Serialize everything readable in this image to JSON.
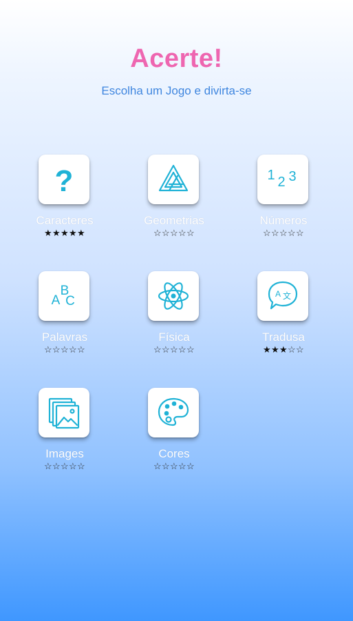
{
  "header": {
    "title": "Acerte!",
    "subtitle": "Escolha um Jogo e divirta-se"
  },
  "games": [
    {
      "label": "Caracteres",
      "icon": "question-mark-icon",
      "rating": 5,
      "max_rating": 5
    },
    {
      "label": "Geometrias",
      "icon": "impossible-triangle-icon",
      "rating": 0,
      "max_rating": 5
    },
    {
      "label": "Números",
      "icon": "numbers-123-icon",
      "rating": 0,
      "max_rating": 5
    },
    {
      "label": "Palavras",
      "icon": "letters-abc-icon",
      "rating": 0,
      "max_rating": 5
    },
    {
      "label": "Física",
      "icon": "atom-icon",
      "rating": 0,
      "max_rating": 5
    },
    {
      "label": "Tradusa",
      "icon": "translate-icon",
      "rating": 3,
      "max_rating": 5
    },
    {
      "label": "Images",
      "icon": "image-stack-icon",
      "rating": 0,
      "max_rating": 5
    },
    {
      "label": "Cores",
      "icon": "palette-icon",
      "rating": 0,
      "max_rating": 5
    }
  ],
  "icon_glyphs": {
    "question": "?",
    "digits": [
      "1",
      "2",
      "3"
    ],
    "letters": [
      "A",
      "B",
      "C"
    ],
    "translate": [
      "A",
      "文"
    ]
  },
  "colors": {
    "title": "#ee66b0",
    "subtitle": "#3f86df",
    "icon": "#1fb2d6",
    "star_filled": "#111111",
    "label": "#ffffff"
  }
}
